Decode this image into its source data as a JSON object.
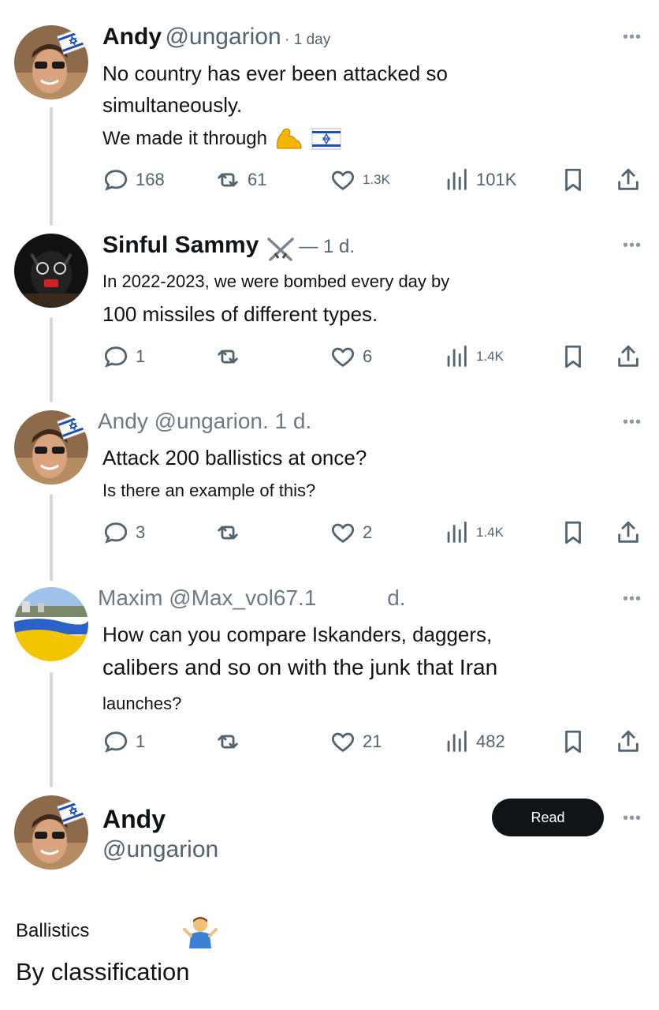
{
  "tweets": [
    {
      "name": "Andy",
      "handle": "@ungarion",
      "time": "· 1 day",
      "line1": "No country has ever been attacked so",
      "line2": "simultaneously.",
      "line3": "We made it through",
      "replies": "168",
      "retweets": "61",
      "likes": "1.3K",
      "views": "101K"
    },
    {
      "name": "Sinful Sammy",
      "time": "— 1 d.",
      "line1": "In 2022-2023, we were bombed every day by",
      "line2": "100 missiles of different types.",
      "replies": "1",
      "retweets": "",
      "likes": "6",
      "views": "1.4K"
    },
    {
      "header": "Andy @ungarion. 1 d.",
      "line1": "Attack 200 ballistics at once?",
      "line2": "Is there an example of this?",
      "replies": "3",
      "retweets": "",
      "likes": "2",
      "views": "1.4K"
    },
    {
      "header_left": "Maxim @Max_vol67.1",
      "header_right": "d.",
      "line1": "How can you compare Iskanders, daggers,",
      "line2": "calibers and so on with the junk that Iran",
      "line3": "launches?",
      "replies": "1",
      "retweets": "",
      "likes": "21",
      "views": "482"
    }
  ],
  "profile": {
    "name": "Andy",
    "handle": "@ungarion",
    "read_label": "Read"
  },
  "more_label": "•••",
  "bottom": {
    "small": "Ballistics",
    "big": "By classification"
  },
  "colors": {
    "text": "#0f1419",
    "muted": "#536471",
    "thread_line": "#cfd9de",
    "button_bg": "#0f1419",
    "israel_blue": "#1d4fb8",
    "muscle_yellow": "#f4b400",
    "ukraine_blue": "#2b62c8",
    "ukraine_yellow": "#f2c500"
  },
  "icons": [
    "reply-icon",
    "retweet-icon",
    "like-icon",
    "views-icon",
    "bookmark-icon",
    "share-icon",
    "flexed-biceps-emoji",
    "israel-flag-emoji",
    "crossed-swords-emoji",
    "shrug-emoji"
  ]
}
